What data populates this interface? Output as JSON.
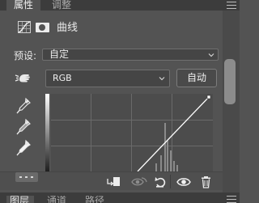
{
  "tabs": {
    "properties": "属性",
    "adjustments": "调整"
  },
  "header": {
    "title": "曲线"
  },
  "preset": {
    "label": "预设:",
    "value": "自定"
  },
  "channel": {
    "value": "RGB"
  },
  "auto_button": "自动",
  "lower_tabs": {
    "layers": "图层",
    "channels": "通道",
    "paths": "路径"
  },
  "icons": {
    "curves": "curves-adjustment-icon",
    "mask": "layer-mask-icon",
    "hand": "on-image-adjustment-hand-icon",
    "black_point": "black-point-eyedropper-icon",
    "gray_point": "gray-point-eyedropper-icon",
    "white_point": "white-point-eyedropper-icon",
    "clip": "clip-to-layer-icon",
    "view_previous": "view-previous-state-icon",
    "reset": "reset-icon",
    "visibility": "eye-icon",
    "delete": "trash-icon",
    "menu": "panel-menu-icon"
  },
  "colors": {
    "panel_bg": "#535353",
    "tab_bar_bg": "#3c3c3c",
    "curve_line": "#ffffff",
    "histogram": "#8c8c8c"
  }
}
